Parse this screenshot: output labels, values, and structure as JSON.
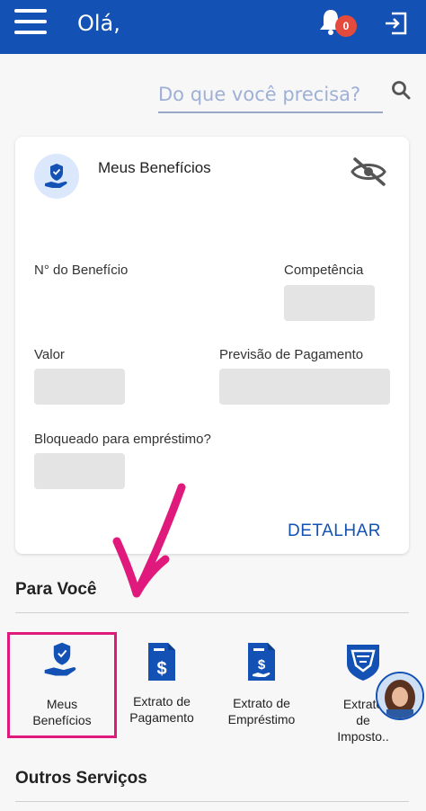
{
  "header": {
    "greeting": "Olá,",
    "notification_count": "0"
  },
  "search": {
    "placeholder": "Do que você precisa?"
  },
  "benefits_card": {
    "title": "Meus Benefícios",
    "benefit_number_label": "N° do Benefício",
    "competence_label": "Competência",
    "value_label": "Valor",
    "payment_forecast_label": "Previsão de Pagamento",
    "blocked_label": "Bloqueado para empréstimo?",
    "detail_button": "DETALHAR"
  },
  "for_you": {
    "title": "Para Você",
    "items": [
      {
        "line1": "Meus",
        "line2": "Benefícios",
        "line3": ""
      },
      {
        "line1": "Extrato de",
        "line2": "Pagamento",
        "line3": ""
      },
      {
        "line1": "Extrato de",
        "line2": "Empréstimo",
        "line3": ""
      },
      {
        "line1": "Extrato",
        "line2": "de",
        "line3": "Imposto.."
      }
    ]
  },
  "other_services": {
    "title": "Outros Serviços"
  },
  "colors": {
    "primary": "#1351b4",
    "highlight": "#e0197d",
    "badge": "#e54b3c"
  }
}
